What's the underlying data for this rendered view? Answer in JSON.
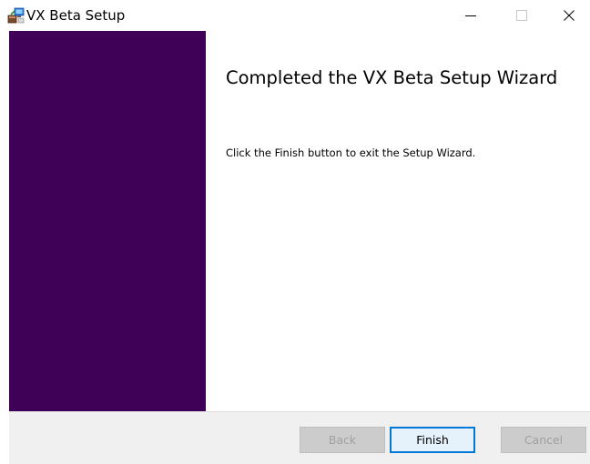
{
  "window": {
    "title": "VX Beta Setup",
    "icon": "setup-installer-icon"
  },
  "banner": {
    "color": "#3f0058"
  },
  "content": {
    "heading": "Completed the VX Beta Setup Wizard",
    "body": "Click the Finish button to exit the Setup Wizard."
  },
  "buttons": {
    "back": "Back",
    "finish": "Finish",
    "cancel": "Cancel"
  },
  "colors": {
    "accent": "#0078d7",
    "footer": "#f0f0f0"
  }
}
